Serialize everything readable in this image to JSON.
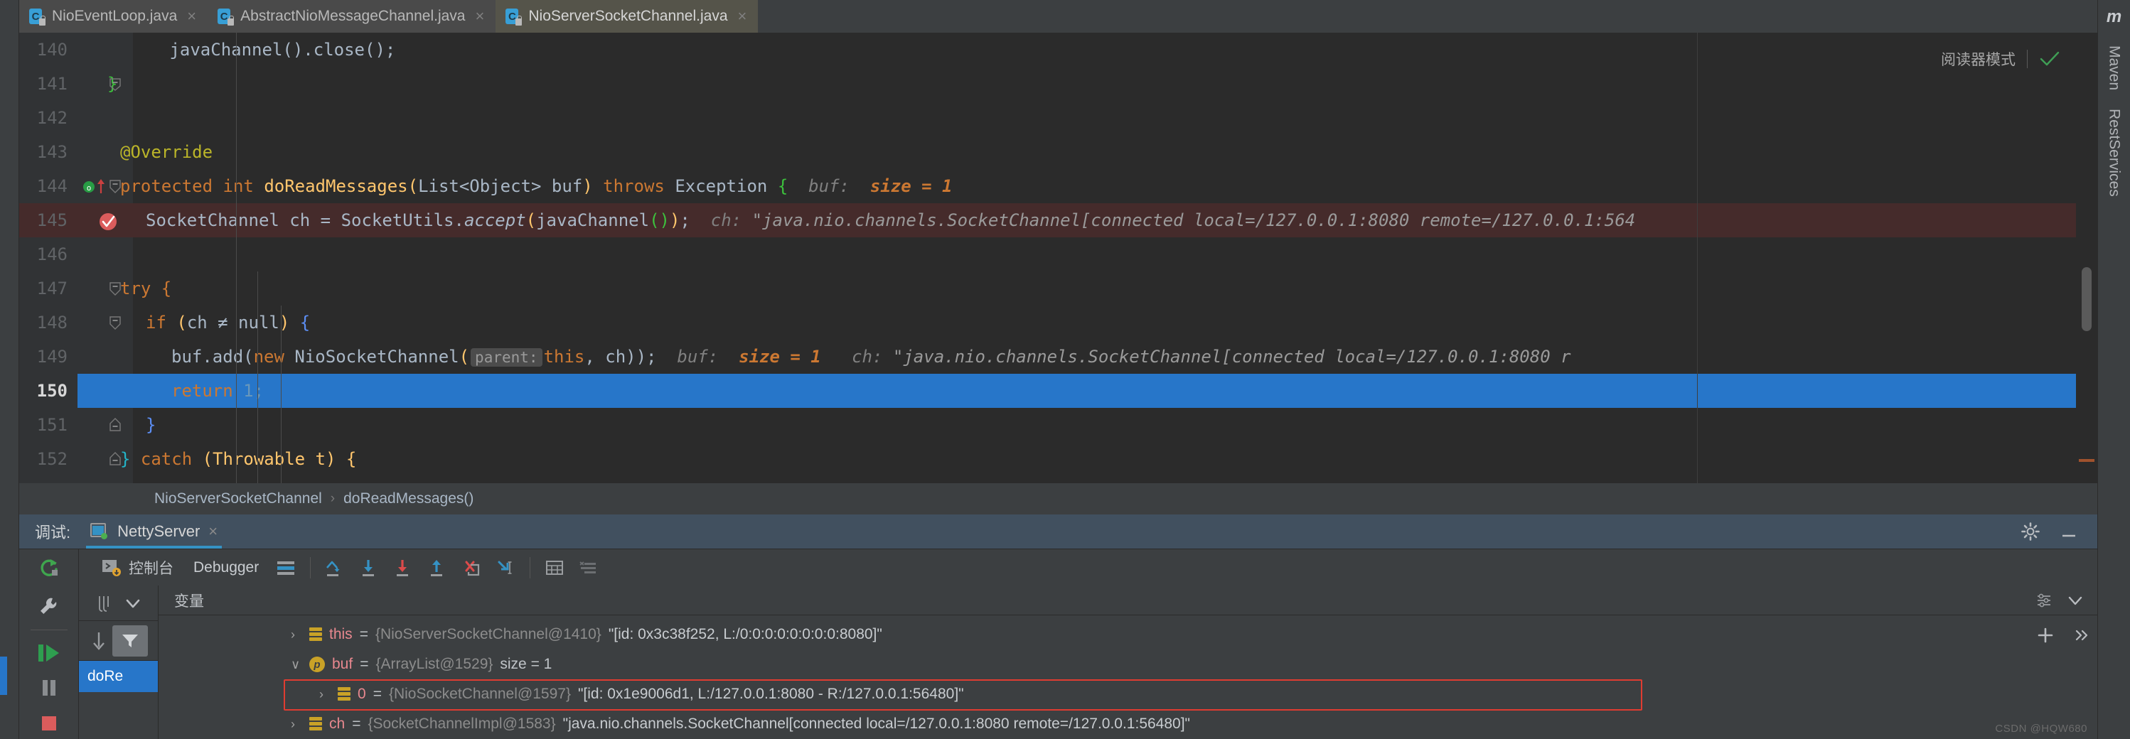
{
  "tabs": [
    {
      "label": "NioEventLoop.java",
      "icon": "java-class-icon",
      "active": false
    },
    {
      "label": "AbstractNioMessageChannel.java",
      "icon": "java-class-icon",
      "active": false
    },
    {
      "label": "NioServerSocketChannel.java",
      "icon": "java-class-icon",
      "active": true
    }
  ],
  "editor": {
    "reader_mode_label": "阅读器模式",
    "lines": [
      {
        "num": "140"
      },
      {
        "num": "141"
      },
      {
        "num": "142"
      },
      {
        "num": "143"
      },
      {
        "num": "144"
      },
      {
        "num": "145"
      },
      {
        "num": "146"
      },
      {
        "num": "147"
      },
      {
        "num": "148"
      },
      {
        "num": "149"
      },
      {
        "num": "150"
      },
      {
        "num": "151"
      },
      {
        "num": "152"
      }
    ],
    "code": {
      "l140": "javaChannel().close();",
      "l141": "}",
      "l143": "@Override",
      "l144_kw1": "protected",
      "l144_kw2": "int",
      "l144_method": "doReadMessages",
      "l144_params": "List<Object> buf",
      "l144_throws": "throws",
      "l144_exc": "Exception",
      "l144_hint_name": "buf:",
      "l144_hint_val": "size = 1",
      "l145_type": "SocketChannel",
      "l145_var": "ch",
      "l145_cls": "SocketUtils.",
      "l145_call": "accept",
      "l145_arg": "javaChannel()",
      "l145_hint_name": "ch:",
      "l145_hint_val": "\"java.nio.channels.SocketChannel[connected local=/127.0.0.1:8080 remote=/127.0.0.1:564",
      "l147": "try {",
      "l148_if": "if",
      "l148_cond": "ch ≠ null",
      "l149_call": "buf.add(",
      "l149_new": "new",
      "l149_cls": "NioSocketChannel",
      "l149_param_badge": "parent:",
      "l149_this": "this",
      "l149_ch": ", ch));",
      "l149_hint1_name": "buf:",
      "l149_hint1_val": "size = 1",
      "l149_hint2_name": "ch:",
      "l149_hint2_val": "\"java.nio.channels.SocketChannel[connected local=/127.0.0.1:8080 r",
      "l150_kw": "return",
      "l150_num": "1;",
      "l151": "}",
      "l152_brace": "}",
      "l152_catch": "catch",
      "l152_exc": "(Throwable t) {"
    }
  },
  "breadcrumb": {
    "class": "NioServerSocketChannel",
    "separator": "›",
    "method": "doReadMessages()"
  },
  "debug": {
    "panel_label": "调试:",
    "config_name": "NettyServer",
    "close_label": "×",
    "toolbar": {
      "console_label": "控制台",
      "debugger_label": "Debugger",
      "icons": [
        "rerun-icon",
        "console-icon",
        "layout-icon",
        "step-over-icon",
        "step-into-icon",
        "force-step-into-icon",
        "step-out-icon",
        "drop-frame-icon",
        "run-to-cursor-icon",
        "evaluate-icon",
        "mute-breakpoints-icon"
      ]
    },
    "side_icons": [
      "settings-wrench-icon",
      "resume-program-icon",
      "pause-program-icon",
      "stop-icon"
    ],
    "frames": {
      "sort_icon": "sort-icon",
      "chevron": "chevron-down-icon",
      "down_icon": "arrow-down-icon",
      "filter_icon": "filter-icon",
      "selected_frame": "doRe"
    },
    "variables_header": "变量",
    "variables": [
      {
        "expander": "›",
        "icon": "field-icon",
        "name": "this",
        "eq": "=",
        "type": "{NioServerSocketChannel@1410}",
        "value": "\"[id: 0x3c38f252, L:/0:0:0:0:0:0:0:0:8080]\"",
        "indent": 0,
        "highlighted": false
      },
      {
        "expander": "∨",
        "icon": "parameter-icon",
        "name": "buf",
        "eq": "=",
        "type": "{ArrayList@1529}",
        "value": "size = 1",
        "indent": 0,
        "highlighted": false
      },
      {
        "expander": "›",
        "icon": "field-icon",
        "name": "0",
        "eq": "=",
        "type": "{NioSocketChannel@1597}",
        "value": "\"[id: 0x1e9006d1, L:/127.0.0.1:8080 - R:/127.0.0.1:56480]\"",
        "indent": 1,
        "highlighted": true
      },
      {
        "expander": "›",
        "icon": "field-icon",
        "name": "ch",
        "eq": "=",
        "type": "{SocketChannelImpl@1583}",
        "value": "\"java.nio.channels.SocketChannel[connected local=/127.0.0.1:8080 remote=/127.0.0.1:56480]\"",
        "indent": 0,
        "highlighted": false
      }
    ],
    "vars_tools": [
      "settings-gear-icon",
      "minimize-icon",
      "layout-settings-icon"
    ],
    "vars_rail": [
      "add-watch-icon",
      "expand-icon"
    ]
  },
  "right_strip": {
    "logo": "m",
    "items": [
      "Maven",
      "RestServices"
    ]
  },
  "watermark": "CSDN @HQW680",
  "colors": {
    "accent": "#3592c4",
    "selection": "#2776c9",
    "error_line": "#452b2b",
    "highlight_border": "#e03c31",
    "bg_editor": "#2b2b2b",
    "bg_chrome": "#3c3f41"
  }
}
